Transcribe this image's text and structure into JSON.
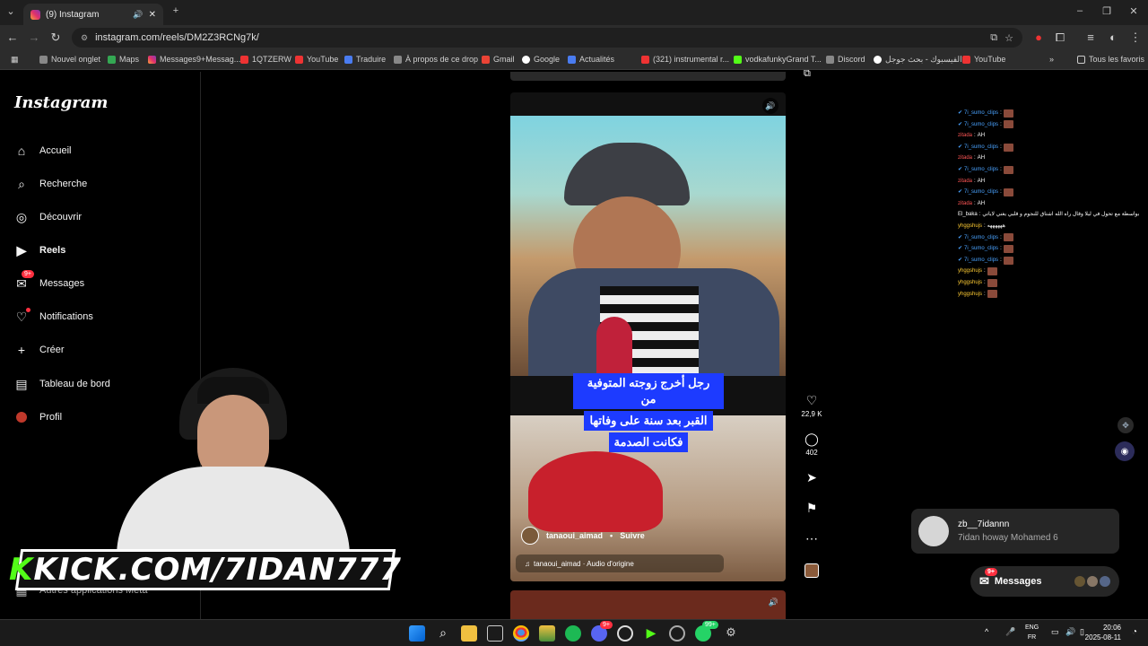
{
  "browser": {
    "tab_title": "(9) Instagram",
    "url": "instagram.com/reels/DM2Z3RCNg7k/",
    "bookmarks": [
      "Nouvel onglet",
      "Maps",
      "Messages9+Messag...",
      "1QTZERW",
      "YouTube",
      "Traduire",
      "À propos de ce drop",
      "Gmail",
      "Google",
      "Actualités",
      "(321) instrumental r...",
      "vodkafunkyGrand T...",
      "Discord",
      "الفيسبوك - بحث جوجل",
      "YouTube"
    ],
    "all_bookmarks": "Tous les favoris"
  },
  "sidebar": {
    "logo": "Instagram",
    "items": [
      {
        "label": "Accueil",
        "icon": "home-icon"
      },
      {
        "label": "Recherche",
        "icon": "search-icon"
      },
      {
        "label": "Découvrir",
        "icon": "compass-icon"
      },
      {
        "label": "Reels",
        "icon": "reels-icon"
      },
      {
        "label": "Messages",
        "icon": "messenger-icon",
        "badge": "9+"
      },
      {
        "label": "Notifications",
        "icon": "heart-icon"
      },
      {
        "label": "Créer",
        "icon": "plus-icon"
      },
      {
        "label": "Tableau de bord",
        "icon": "dashboard-icon"
      },
      {
        "label": "Profil",
        "icon": "profile-avatar-icon"
      }
    ],
    "meta_apps": "Autres applications Meta"
  },
  "reel": {
    "caption_lines": [
      "رجل أخرج زوجته المتوفية من",
      "القبر بعد سنة على وفاتها",
      "فكانت الصدمة"
    ],
    "author": "tanaoui_aimad",
    "follow": "Suivre",
    "audio": "tanaoui_aimad · Audio d'origine",
    "likes": "22,9 K",
    "comments": "402"
  },
  "chat": [
    {
      "user": "7i_sumo_clips",
      "color": "#4aa3ff",
      "msg": ""
    },
    {
      "user": "7i_sumo_clips",
      "color": "#4aa3ff",
      "msg": ""
    },
    {
      "user": "zitada",
      "color": "#ff5555",
      "msg": "AH"
    },
    {
      "user": "7i_sumo_clips",
      "color": "#4aa3ff",
      "msg": ""
    },
    {
      "user": "zitada",
      "color": "#ff5555",
      "msg": "AH"
    },
    {
      "user": "7i_sumo_clips",
      "color": "#4aa3ff",
      "msg": ""
    },
    {
      "user": "zitada",
      "color": "#ff5555",
      "msg": "AH"
    },
    {
      "user": "7i_sumo_clips",
      "color": "#4aa3ff",
      "msg": ""
    },
    {
      "user": "zitada",
      "color": "#ff5555",
      "msg": "AH"
    },
    {
      "user": "El_baka",
      "color": "#ffffff",
      "msg": "بواسطة مع تحول في ليلا وقال راه الله اشتاق للنجوم و قلبي يغني لاياتي"
    },
    {
      "user": "yhggshujs",
      "color": "#ffcc33",
      "msg": "ههههههه"
    },
    {
      "user": "7i_sumo_clips",
      "color": "#4aa3ff",
      "msg": ""
    },
    {
      "user": "7i_sumo_clips",
      "color": "#4aa3ff",
      "msg": ""
    },
    {
      "user": "7i_sumo_clips",
      "color": "#4aa3ff",
      "msg": ""
    },
    {
      "user": "yhggshujs",
      "color": "#ffcc33",
      "msg": ""
    },
    {
      "user": "yhggshujs",
      "color": "#ffcc33",
      "msg": ""
    },
    {
      "user": "yhggshujs",
      "color": "#ffcc33",
      "msg": ""
    }
  ],
  "notification": {
    "name": "zb__7idannn",
    "text": "7idan howay Mohamed 6"
  },
  "messages_button": {
    "label": "Messages",
    "badge": "9+"
  },
  "overlay": {
    "kick_k": "K",
    "kick_text": "KICK.COM/7IDAN777"
  },
  "taskbar": {
    "lang1": "ENG",
    "lang2": "FR",
    "time": "20:06",
    "date": "2025-08-11",
    "badge1": "9+",
    "badge2": "99+"
  }
}
